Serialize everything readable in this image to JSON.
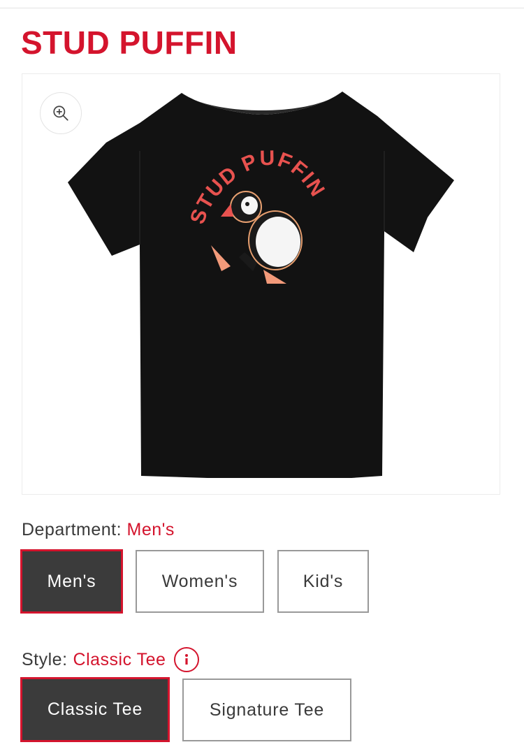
{
  "product": {
    "title": "STUD PUFFIN",
    "graphic_text": "STUD PUFFIN",
    "shirt_color": "#111111",
    "print_color": "#e8524f"
  },
  "gallery": {
    "zoom_icon": "zoom-in-icon"
  },
  "department": {
    "label": "Department:",
    "selected": "Men's",
    "options": [
      "Men's",
      "Women's",
      "Kid's"
    ]
  },
  "style": {
    "label": "Style:",
    "selected": "Classic Tee",
    "info_icon": "info-icon",
    "options": [
      "Classic Tee",
      "Signature Tee"
    ]
  },
  "colors": {
    "accent": "#d4142d",
    "selected_bg": "#3b3b3b"
  }
}
